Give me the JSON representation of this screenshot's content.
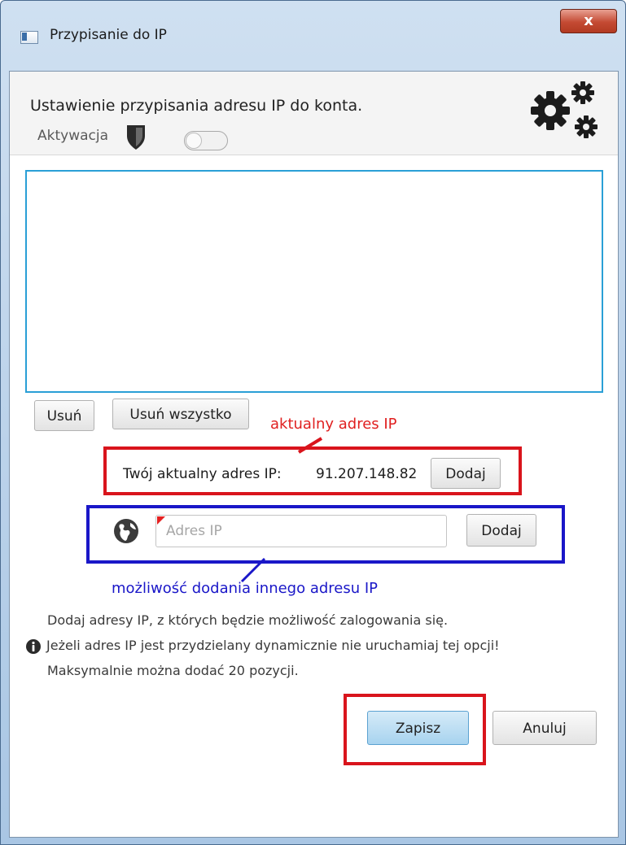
{
  "window": {
    "title": "Przypisanie do IP",
    "close_label": "x"
  },
  "header": {
    "text": "Ustawienie przypisania adresu IP do konta.",
    "icon": "gears-icon"
  },
  "activation": {
    "label": "Aktywacja",
    "icon": "shield-icon",
    "toggle_on": false
  },
  "ip_list": {
    "items": []
  },
  "list_actions": {
    "remove_label": "Usuń",
    "remove_all_label": "Usuń wszystko"
  },
  "current_ip": {
    "label": "Twój aktualny adres IP:",
    "value": "91.207.148.82",
    "add_label": "Dodaj"
  },
  "other_ip": {
    "placeholder": "Adres IP",
    "add_label": "Dodaj",
    "icon": "globe-icon"
  },
  "annotations": {
    "current_ip": "aktualny adres IP",
    "other_ip": "możliwość dodania innego adresu IP",
    "red_color": "#d9141c",
    "blue_color": "#1a17c8"
  },
  "info": {
    "line1": "Dodaj adresy IP, z których będzie możliwość zalogowania się.",
    "line2": "Jeżeli adres IP jest przydzielany dynamicznie nie uruchamiaj tej opcji!",
    "line3": "Maksymalnie można dodać 20 pozycji.",
    "icon": "info-icon"
  },
  "footer": {
    "save_label": "Zapisz",
    "cancel_label": "Anuluj"
  },
  "colors": {
    "list_border": "#2a9fd6",
    "accent_button": "#a7d3ef"
  }
}
